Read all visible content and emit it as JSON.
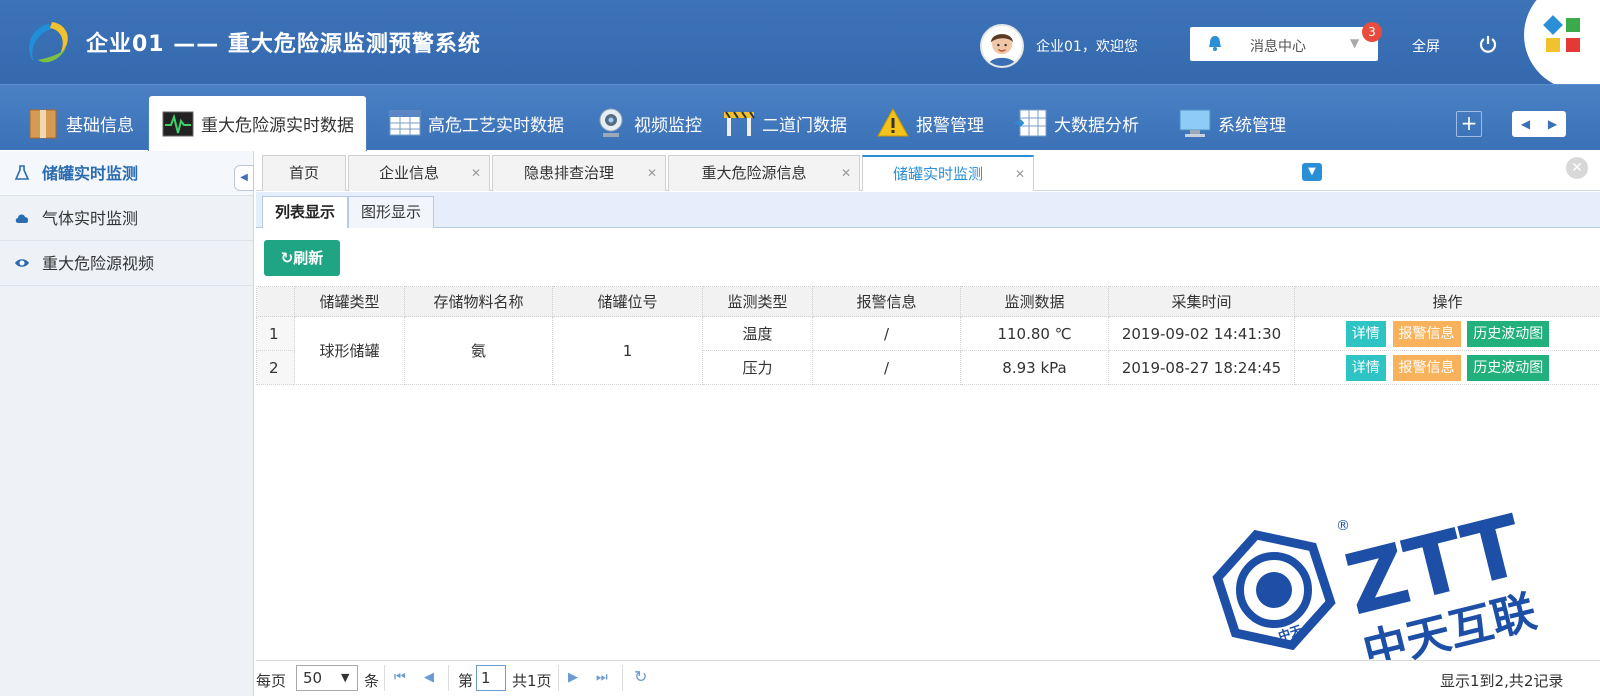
{
  "header": {
    "title": "企业01 —— 重大危险源监测预警系统",
    "welcome": "企业01，欢迎您",
    "message_center": "消息中心",
    "message_count": "3",
    "fullscreen": "全屏"
  },
  "topnav": {
    "items": [
      {
        "label": "基础信息",
        "icon": "package-icon"
      },
      {
        "label": "重大危险源实时数据",
        "icon": "monitor-pulse-icon"
      },
      {
        "label": "高危工艺实时数据",
        "icon": "table-icon"
      },
      {
        "label": "视频监控",
        "icon": "webcam-icon"
      },
      {
        "label": "二道门数据",
        "icon": "barrier-gate-icon"
      },
      {
        "label": "报警管理",
        "icon": "warning-icon"
      },
      {
        "label": "大数据分析",
        "icon": "grid-arrow-icon"
      },
      {
        "label": "系统管理",
        "icon": "computer-icon"
      }
    ],
    "active_index": 1
  },
  "sidebar": {
    "items": [
      {
        "label": "储罐实时监测",
        "icon": "flask-icon"
      },
      {
        "label": "气体实时监测",
        "icon": "cloud-icon"
      },
      {
        "label": "重大危险源视频",
        "icon": "eye-icon"
      }
    ],
    "active_index": 0
  },
  "tabs": [
    {
      "label": "首页"
    },
    {
      "label": "企业信息"
    },
    {
      "label": "隐患排查治理"
    },
    {
      "label": "重大危险源信息"
    },
    {
      "label": "储罐实时监测"
    }
  ],
  "subtabs": [
    {
      "label": "列表显示"
    },
    {
      "label": "图形显示"
    }
  ],
  "toolbar": {
    "refresh": "刷新"
  },
  "table": {
    "columns": [
      "储罐类型",
      "存储物料名称",
      "储罐位号",
      "监测类型",
      "报警信息",
      "监测数据",
      "采集时间",
      "操作"
    ],
    "group": {
      "tank_type": "球形储罐",
      "material": "氨",
      "tag": "1"
    },
    "rows": [
      {
        "num": "1",
        "monitor_type": "温度",
        "alarm": "/",
        "data": "110.80 ℃",
        "time": "2019-09-02 14:41:30"
      },
      {
        "num": "2",
        "monitor_type": "压力",
        "alarm": "/",
        "data": "8.93 kPa",
        "time": "2019-08-27 18:24:45"
      }
    ],
    "actions": {
      "detail": "详情",
      "alarm": "报警信息",
      "history": "历史波动图"
    }
  },
  "pager": {
    "per_page_prefix": "每页",
    "per_page_value": "50",
    "per_page_suffix": "条",
    "page_prefix": "第",
    "page_value": "1",
    "total_pages": "共1页",
    "summary": "显示1到2,共2记录"
  },
  "watermark": {
    "brand": "ZTT",
    "cn_brand": "中天互联",
    "seal_text": "中天",
    "registered": "®"
  },
  "colors": {
    "header_blue": "#3469ae",
    "accent_blue": "#2b8fd8",
    "refresh_green": "#1fa583",
    "detail_teal": "#2ec4c4",
    "alarm_orange": "#f8b25c",
    "history_green": "#22b07d",
    "badge_red": "#e74c3c"
  }
}
